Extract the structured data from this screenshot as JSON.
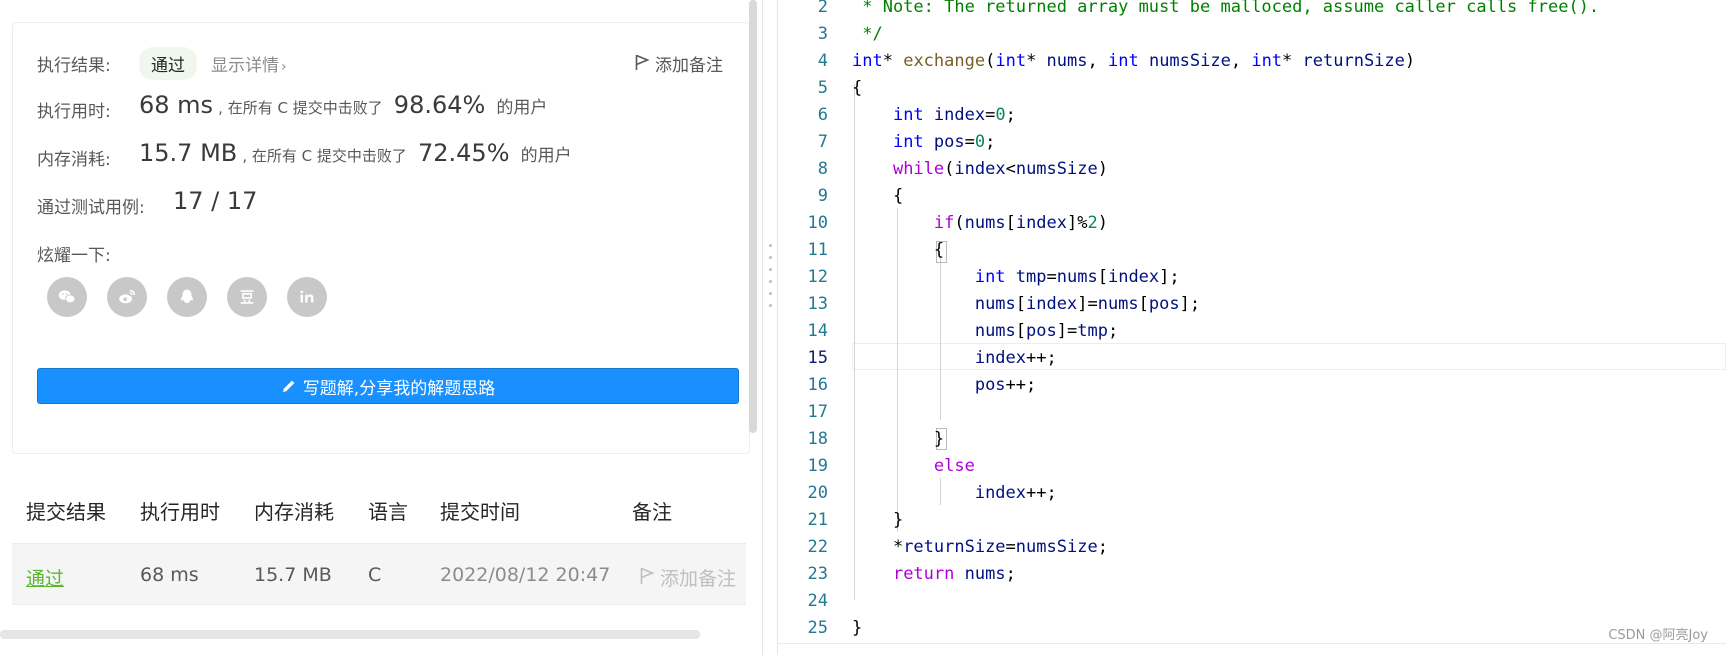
{
  "result": {
    "label": "执行结果:",
    "status": "通过",
    "detail_link": "显示详情",
    "detail_chevron": "›",
    "add_note": "添加备注"
  },
  "runtime": {
    "label": "执行用时:",
    "value": "68 ms",
    "text": ", 在所有 C 提交中击败了",
    "percent": "98.64%",
    "suffix": "的用户"
  },
  "memory": {
    "label": "内存消耗:",
    "value": "15.7 MB",
    "text": ", 在所有 C 提交中击败了",
    "percent": "72.45%",
    "suffix": "的用户"
  },
  "tests": {
    "label": "通过测试用例:",
    "value": "17 / 17"
  },
  "share": {
    "label": "炫耀一下:",
    "icons": [
      "wechat-icon",
      "weibo-icon",
      "qq-icon",
      "douban-icon",
      "linkedin-icon"
    ]
  },
  "write_button": "写题解,分享我的解题思路",
  "submissions": {
    "headers": [
      "提交结果",
      "执行用时",
      "内存消耗",
      "语言",
      "提交时间",
      "备注"
    ],
    "rows": [
      {
        "status": "通过",
        "runtime": "68 ms",
        "memory": "15.7 MB",
        "language": "C",
        "time": "2022/08/12 20:47",
        "note": "添加备注"
      }
    ]
  },
  "code": {
    "line_numbers": [
      "2",
      "3",
      "4",
      "5",
      "6",
      "7",
      "8",
      "9",
      "10",
      "11",
      "12",
      "13",
      "14",
      "15",
      "16",
      "17",
      "18",
      "19",
      "20",
      "21",
      "22",
      "23",
      "24",
      "25"
    ],
    "current_line": "15"
  },
  "watermark": "CSDN @阿亮Joy",
  "colors": {
    "accent": "#1890ff",
    "success": "#5cb531",
    "keyword": "#0000ff",
    "comment": "#008000"
  }
}
